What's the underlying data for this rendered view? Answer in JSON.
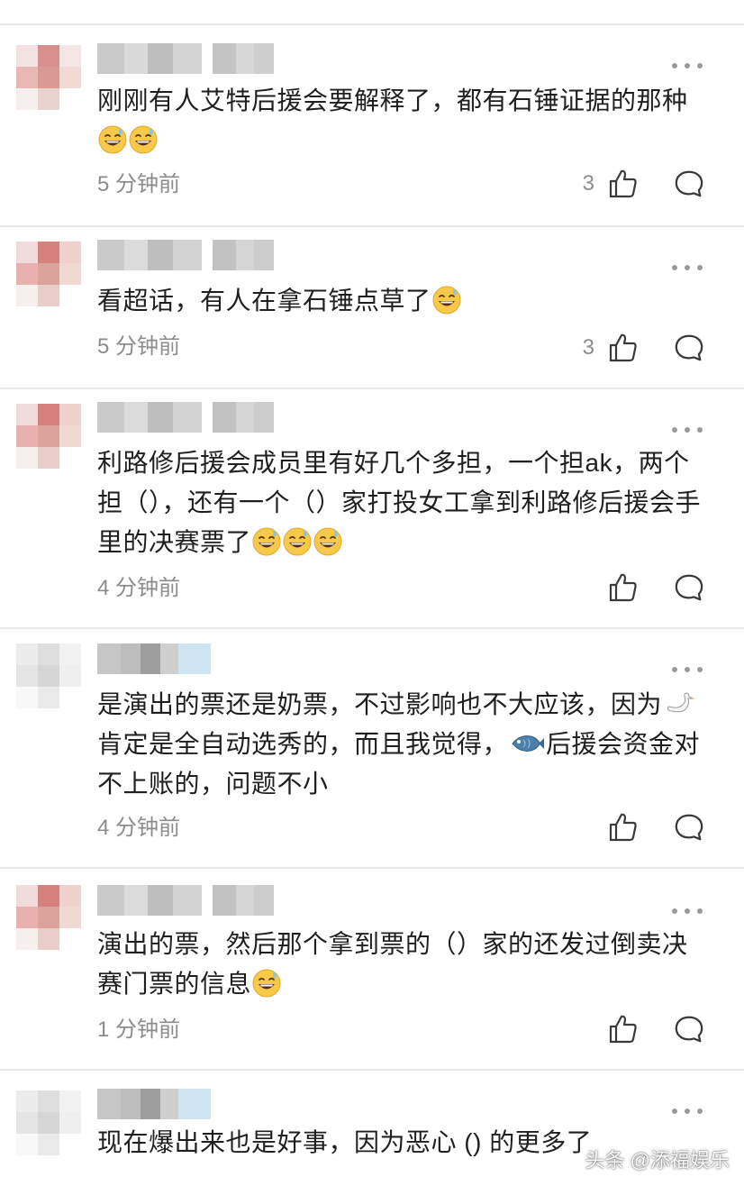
{
  "comments": [
    {
      "text_parts": [
        "刚刚有人艾特后援会要解释了，都有石锤证据的那种"
      ],
      "emoji_count": 2,
      "time": "5 分钟前",
      "likes": "3"
    },
    {
      "text_parts": [
        "看超话，有人在拿石锤点草了"
      ],
      "emoji_count": 1,
      "time": "5 分钟前",
      "likes": "3"
    },
    {
      "text_parts": [
        "利路修后援会成员里有好几个多担，一个担ak，两个担（），还有一个（）家打投女工拿到利路修后援会手里的决赛票了"
      ],
      "emoji_count": 3,
      "time": "4 分钟前",
      "likes": ""
    },
    {
      "text_parts": [
        "是演出的票还是奶票，不过影响也不大应该，因为",
        "肯定是全自动选秀的，而且我觉得，",
        "后援会资金对不上账的，问题不小"
      ],
      "emoji_count": 0,
      "time": "4 分钟前",
      "likes": ""
    },
    {
      "text_parts": [
        "演出的票，然后那个拿到票的（）家的还发过倒卖决赛门票的信息"
      ],
      "emoji_count": 1,
      "time": "1 分钟前",
      "likes": ""
    },
    {
      "text_parts": [
        "现在爆出来也是好事，因为恶心 () 的更多了"
      ],
      "emoji_count": 0,
      "time": "",
      "likes": ""
    }
  ],
  "icons": {
    "like": "thumbs-up-icon",
    "reply": "comment-bubble-icon",
    "more": "more-dots-icon",
    "emoji": "grinning-sweat-emoji",
    "swan": "swan-emoji",
    "fish": "fish-emoji"
  },
  "watermark": "头条 @添福娱乐",
  "colors": {
    "text": "#1f1f1f",
    "meta": "#8c8c8c",
    "divider": "#e9e9e9"
  }
}
